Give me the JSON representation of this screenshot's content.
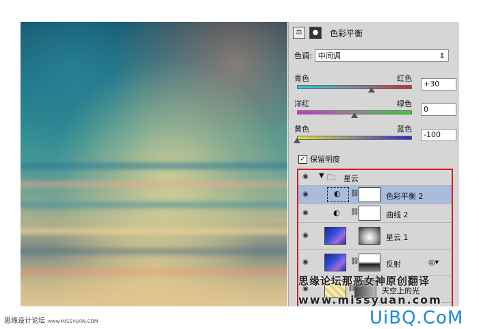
{
  "panel": {
    "title": "色彩平衡",
    "tone_label": "色调:",
    "tone_value": "中间调",
    "sliders": [
      {
        "left": "青色",
        "right": "红色",
        "value": "+30",
        "fraction": 0.65,
        "track": "linear-gradient(90deg,#2fc9d6,#7a8aa8,#d22a2a)"
      },
      {
        "left": "洋红",
        "right": "绿色",
        "value": "0",
        "fraction": 0.5,
        "track": "linear-gradient(90deg,#d22ad2,#8a8a8a,#2ad22a)"
      },
      {
        "left": "黄色",
        "right": "蓝色",
        "value": "-100",
        "fraction": 0.0,
        "track": "linear-gradient(90deg,#e6e02a,#8a8a8a,#2a2ad2)"
      }
    ],
    "preserve_luminosity": "保留明度"
  },
  "layers": {
    "group": "星云",
    "items": [
      {
        "name": "色彩平衡 2"
      },
      {
        "name": "曲线 2"
      },
      {
        "name": "星云 1"
      },
      {
        "name": "反射"
      },
      {
        "name": "天空上的光"
      }
    ]
  },
  "watermark": {
    "line1": "思缘论坛那恶女神原创翻译",
    "line2": "www.missyuan.com"
  },
  "footer": {
    "left": "思缘设计论坛",
    "left_url": "www.MISSYUAN.COM",
    "right": "UiBQ.CoM"
  },
  "colors": {
    "highlight": "#d21a1a",
    "selected_row": "#a9bcdc",
    "brand": "#1a8ad8"
  }
}
